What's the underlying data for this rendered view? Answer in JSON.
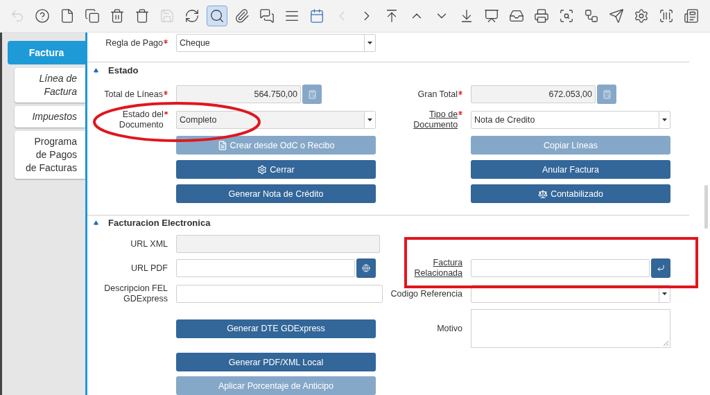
{
  "toolbar": {
    "buttons": [
      {
        "disabled": true,
        "selected": false
      },
      {
        "disabled": false,
        "selected": false
      },
      {
        "disabled": false,
        "selected": false
      },
      {
        "disabled": false,
        "selected": false
      },
      {
        "disabled": false,
        "selected": false
      },
      {
        "disabled": false,
        "selected": false
      },
      {
        "disabled": true,
        "selected": false
      },
      {
        "disabled": false,
        "selected": false
      },
      {
        "disabled": false,
        "selected": true
      },
      {
        "disabled": false,
        "selected": false
      },
      {
        "disabled": false,
        "selected": false
      },
      {
        "disabled": false,
        "selected": false
      },
      {
        "disabled": false,
        "selected": false
      },
      {
        "disabled": true,
        "selected": false
      },
      {
        "disabled": false,
        "selected": false
      },
      {
        "disabled": false,
        "selected": false
      },
      {
        "disabled": false,
        "selected": false
      },
      {
        "disabled": false,
        "selected": false
      },
      {
        "disabled": false,
        "selected": false
      },
      {
        "disabled": false,
        "selected": false
      },
      {
        "disabled": false,
        "selected": false
      },
      {
        "disabled": false,
        "selected": false
      },
      {
        "disabled": false,
        "selected": false
      },
      {
        "disabled": false,
        "selected": false
      },
      {
        "disabled": false,
        "selected": false
      },
      {
        "disabled": false,
        "selected": false
      },
      {
        "disabled": false,
        "selected": false
      },
      {
        "disabled": false,
        "selected": false
      }
    ]
  },
  "sidebar": {
    "tabs": [
      {
        "label": "Factura",
        "selected": true,
        "italic": false
      },
      {
        "label": "Línea de Factura",
        "selected": false,
        "italic": true
      },
      {
        "label": "Impuestos",
        "selected": false,
        "italic": true
      },
      {
        "label": "Programa de Pagos de Facturas",
        "selected": false,
        "italic": false
      }
    ]
  },
  "top_field": {
    "label": "Regla de Pago",
    "required": true,
    "link": false,
    "kind": "select",
    "value": "Cheque",
    "readonly": false
  },
  "sections": [
    {
      "title": "Estado",
      "expanded": true,
      "rows": [
        [
          {
            "label": "Total de Líneas",
            "required": true,
            "link": false,
            "kind": "amount",
            "value": "564.750,00",
            "readonly": true
          },
          {
            "label": "Gran Total",
            "required": true,
            "link": false,
            "kind": "amount",
            "value": "672.053,00",
            "readonly": true
          }
        ],
        [
          {
            "label": "Estado del Documento",
            "required": true,
            "link": false,
            "kind": "select",
            "value": "Completo",
            "readonly": true
          },
          {
            "label": "Tipo de Documento",
            "required": true,
            "link": true,
            "kind": "select",
            "value": "Nota de Credito",
            "readonly": false
          }
        ],
        [
          {
            "kind": "button",
            "text": "Crear desde OdC o Recibo",
            "disabled": true
          },
          {
            "kind": "button",
            "text": "Copiar Líneas",
            "disabled": true
          }
        ],
        [
          {
            "kind": "button",
            "text": "Cerrar",
            "disabled": false
          },
          {
            "kind": "button",
            "text": "Anular Factura",
            "disabled": false
          }
        ],
        [
          {
            "kind": "button",
            "text": "Generar Nota de Crédito",
            "disabled": false
          },
          {
            "kind": "button",
            "text": "Contabilizado",
            "disabled": false
          }
        ]
      ]
    },
    {
      "title": "Facturacion Electronica",
      "expanded": true,
      "rows": [
        [
          {
            "label": "URL XML",
            "required": false,
            "link": false,
            "kind": "text",
            "readonly": true
          },
          {
            "kind": "empty"
          }
        ],
        [
          {
            "label": "URL PDF",
            "required": false,
            "link": false,
            "kind": "url",
            "readonly": false
          },
          {
            "label": "Factura Relacionada",
            "required": false,
            "link": true,
            "kind": "lookup",
            "readonly": false
          }
        ],
        [
          {
            "label": "Descripcion FEL GDExpress",
            "required": false,
            "link": false,
            "kind": "text",
            "readonly": false
          },
          {
            "label": "Codigo Referencia",
            "required": false,
            "link": false,
            "kind": "select",
            "readonly": false
          }
        ],
        [
          {
            "kind": "button",
            "text": "Generar DTE GDExpress",
            "disabled": false
          },
          {
            "label": "Motivo",
            "required": false,
            "link": false,
            "kind": "textarea",
            "readonly": false
          }
        ],
        [
          {
            "kind": "button",
            "text": "Generar PDF/XML Local",
            "disabled": false
          },
          {
            "kind": "empty"
          }
        ],
        [
          {
            "kind": "button",
            "text": "Aplicar Porcentaje de Anticipo",
            "disabled": true
          },
          {
            "kind": "empty"
          }
        ]
      ]
    }
  ]
}
